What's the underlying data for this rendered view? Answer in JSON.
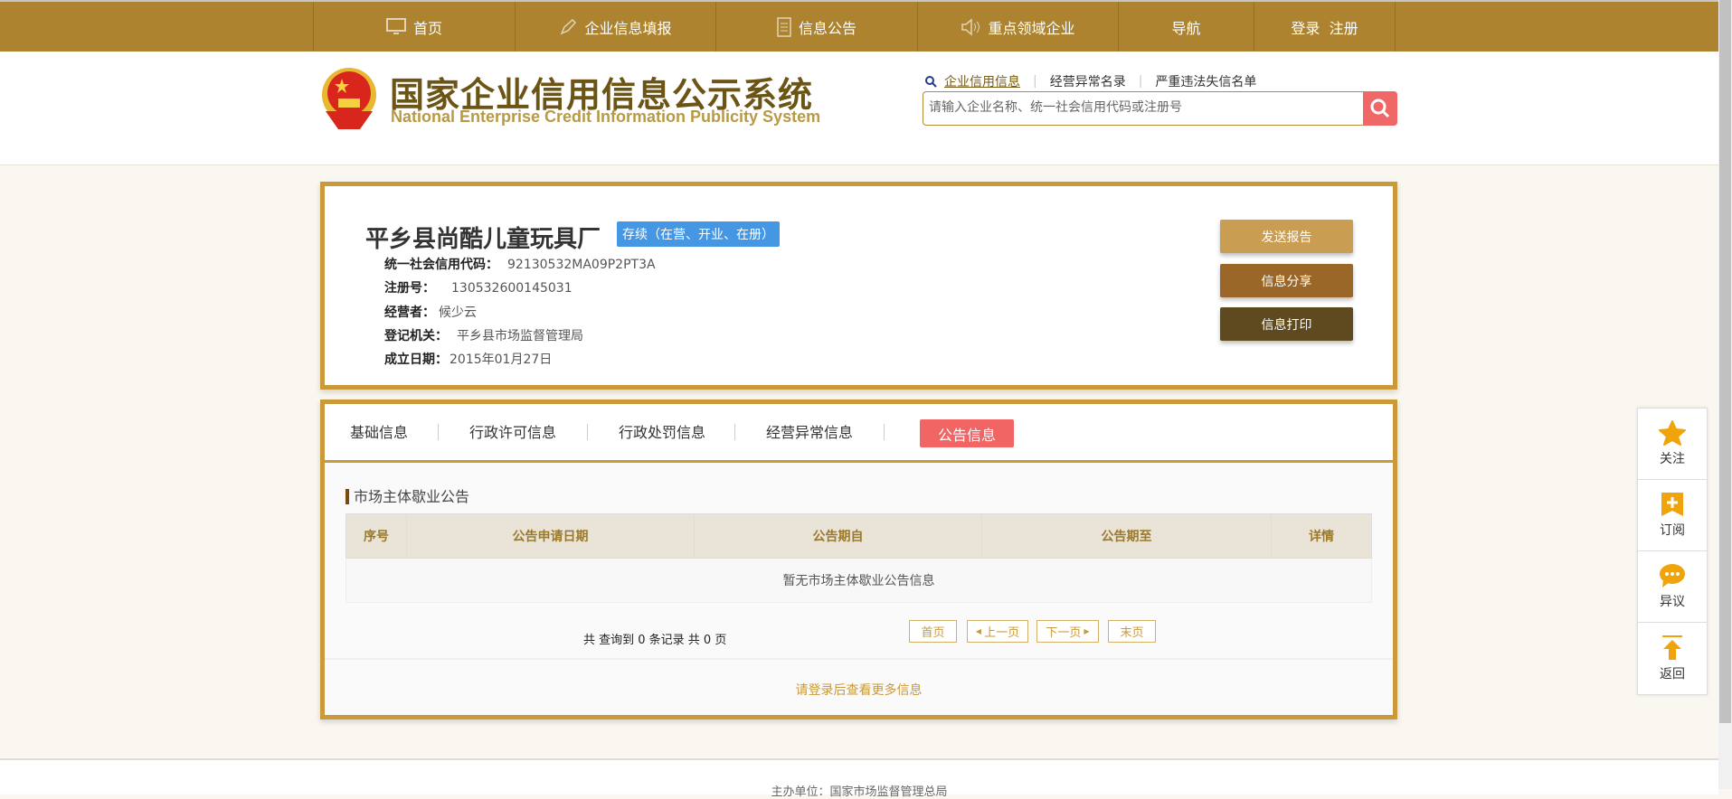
{
  "nav": {
    "items": [
      "首页",
      "企业信息填报",
      "信息公告",
      "重点领域企业",
      "导航",
      "登录  注册"
    ]
  },
  "header": {
    "title": "国家企业信用信息公示系统",
    "subtitle": "National Enterprise Credit Information Publicity System",
    "search_links": [
      "企业信用信息",
      "经营异常名录",
      "严重违法失信名单"
    ],
    "search_placeholder": "请输入企业名称、统一社会信用代码或注册号"
  },
  "company": {
    "name": "平乡县尚酷儿童玩具厂",
    "status": "存续（在营、开业、在册）",
    "fields": [
      {
        "label": "统一社会信用代码：",
        "value": "92130532MA09P2PT3A"
      },
      {
        "label": "注册号：",
        "value": "130532600145031"
      },
      {
        "label": "经营者：",
        "value": "候少云"
      },
      {
        "label": "登记机关：",
        "value": "平乡县市场监督管理局"
      },
      {
        "label": "成立日期：",
        "value": "2015年01月27日"
      }
    ],
    "actions": [
      "发送报告",
      "信息分享",
      "信息打印"
    ]
  },
  "tabs": [
    "基础信息",
    "行政许可信息",
    "行政处罚信息",
    "经营异常信息",
    "公告信息"
  ],
  "section": {
    "title": "市场主体歇业公告",
    "columns": [
      "序号",
      "公告申请日期",
      "公告期自",
      "公告期至",
      "详情"
    ],
    "empty": "暂无市场主体歇业公告信息",
    "pagination_text": "共 查询到 0 条记录 共 0 页",
    "pager": [
      "首页",
      "上一页",
      "下一页",
      "末页"
    ],
    "login_more": "请登录后查看更多信息"
  },
  "footer": {
    "text": "主办单位：国家市场监督管理总局"
  },
  "sidebar": [
    "关注",
    "订阅",
    "异议",
    "返回"
  ],
  "colors": {
    "nav": "#ad832f",
    "border": "#c9993a",
    "active_tab": "#f26565",
    "status": "#4697e3",
    "icon": "#f0a30a"
  }
}
